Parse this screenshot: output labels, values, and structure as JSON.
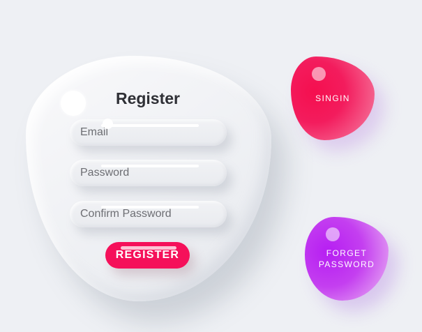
{
  "register_form": {
    "title": "Register",
    "email_placeholder": "Email",
    "password_placeholder": "Password",
    "confirm_password_placeholder": "Confirm Password",
    "submit_label": "REGISTER"
  },
  "side_buttons": {
    "signin_label": "SINGIN",
    "forget_label_line1": "FORGET",
    "forget_label_line2": "PASSWORD"
  },
  "colors": {
    "background": "#eef0f4",
    "register_accent": "#f5105a",
    "signin_blob": "#f31c5d",
    "forget_blob": "#c43ff0"
  }
}
